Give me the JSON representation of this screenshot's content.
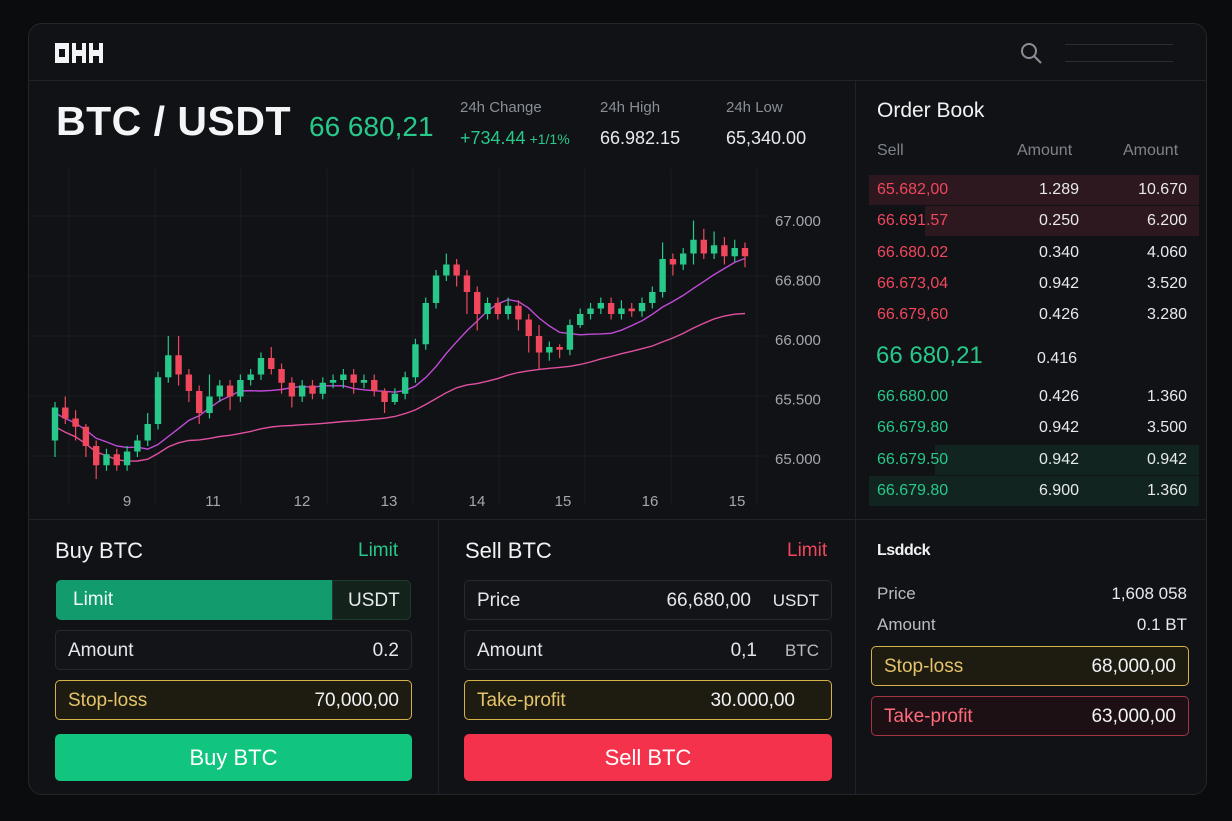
{
  "brand": {
    "logo": "OKX"
  },
  "header": {
    "pair": "BTC / USDT",
    "last_price": "66 680,21"
  },
  "stats": [
    {
      "label": "24h Change",
      "value": "+734.44",
      "sub": "+1/1%"
    },
    {
      "label": "24h High",
      "value": "66.982.15"
    },
    {
      "label": "24h Low",
      "value": "65,340.00"
    }
  ],
  "colors": {
    "up": "#27c88a",
    "down": "#f0475d",
    "ma_fast": "#c14bd8",
    "ma_slow": "#e0509e",
    "accent_gold": "#d6b34a"
  },
  "chart_data": {
    "type": "candlestick",
    "y_tick_labels": [
      "67.000",
      "66.800",
      "66.000",
      "65.500",
      "65.000"
    ],
    "x_tick_labels": [
      "9",
      "11",
      "12",
      "13",
      "14",
      "15",
      "16",
      "15"
    ],
    "series": [
      {
        "values": [
          [
            0.14,
            0.26,
            0.08,
            0.28
          ],
          [
            0.26,
            0.22,
            0.2,
            0.3
          ],
          [
            0.22,
            0.19,
            0.14,
            0.25
          ],
          [
            0.19,
            0.12,
            0.08,
            0.2
          ],
          [
            0.12,
            0.05,
            0.0,
            0.14
          ],
          [
            0.05,
            0.09,
            0.03,
            0.11
          ],
          [
            0.09,
            0.05,
            0.03,
            0.11
          ],
          [
            0.05,
            0.1,
            0.03,
            0.12
          ],
          [
            0.1,
            0.14,
            0.08,
            0.16
          ],
          [
            0.14,
            0.2,
            0.12,
            0.24
          ],
          [
            0.2,
            0.37,
            0.18,
            0.39
          ],
          [
            0.37,
            0.45,
            0.35,
            0.52
          ],
          [
            0.45,
            0.38,
            0.34,
            0.52
          ],
          [
            0.38,
            0.32,
            0.28,
            0.4
          ],
          [
            0.32,
            0.24,
            0.2,
            0.34
          ],
          [
            0.24,
            0.3,
            0.22,
            0.38
          ],
          [
            0.3,
            0.34,
            0.28,
            0.36
          ],
          [
            0.34,
            0.3,
            0.25,
            0.36
          ],
          [
            0.3,
            0.36,
            0.28,
            0.38
          ],
          [
            0.36,
            0.38,
            0.34,
            0.4
          ],
          [
            0.38,
            0.44,
            0.36,
            0.46
          ],
          [
            0.44,
            0.4,
            0.38,
            0.48
          ],
          [
            0.4,
            0.35,
            0.31,
            0.42
          ],
          [
            0.35,
            0.3,
            0.26,
            0.37
          ],
          [
            0.3,
            0.34,
            0.28,
            0.36
          ],
          [
            0.34,
            0.31,
            0.29,
            0.36
          ],
          [
            0.31,
            0.35,
            0.29,
            0.37
          ],
          [
            0.35,
            0.36,
            0.33,
            0.38
          ],
          [
            0.36,
            0.38,
            0.33,
            0.4
          ],
          [
            0.38,
            0.35,
            0.31,
            0.4
          ],
          [
            0.35,
            0.36,
            0.33,
            0.38
          ],
          [
            0.36,
            0.32,
            0.3,
            0.38
          ],
          [
            0.32,
            0.28,
            0.24,
            0.33
          ],
          [
            0.28,
            0.31,
            0.27,
            0.33
          ],
          [
            0.31,
            0.37,
            0.29,
            0.39
          ],
          [
            0.37,
            0.49,
            0.35,
            0.51
          ],
          [
            0.49,
            0.64,
            0.47,
            0.66
          ],
          [
            0.64,
            0.74,
            0.62,
            0.76
          ],
          [
            0.74,
            0.78,
            0.72,
            0.82
          ],
          [
            0.78,
            0.74,
            0.7,
            0.8
          ],
          [
            0.74,
            0.68,
            0.6,
            0.76
          ],
          [
            0.68,
            0.6,
            0.54,
            0.7
          ],
          [
            0.6,
            0.64,
            0.58,
            0.66
          ],
          [
            0.64,
            0.6,
            0.58,
            0.66
          ],
          [
            0.6,
            0.63,
            0.58,
            0.66
          ],
          [
            0.63,
            0.58,
            0.54,
            0.65
          ],
          [
            0.58,
            0.52,
            0.46,
            0.6
          ],
          [
            0.52,
            0.46,
            0.4,
            0.56
          ],
          [
            0.46,
            0.48,
            0.43,
            0.5
          ],
          [
            0.48,
            0.47,
            0.44,
            0.49
          ],
          [
            0.47,
            0.56,
            0.45,
            0.58
          ],
          [
            0.56,
            0.6,
            0.55,
            0.62
          ],
          [
            0.6,
            0.62,
            0.58,
            0.64
          ],
          [
            0.62,
            0.64,
            0.6,
            0.66
          ],
          [
            0.64,
            0.6,
            0.58,
            0.66
          ],
          [
            0.6,
            0.62,
            0.58,
            0.65
          ],
          [
            0.62,
            0.61,
            0.59,
            0.64
          ],
          [
            0.61,
            0.64,
            0.59,
            0.66
          ],
          [
            0.64,
            0.68,
            0.62,
            0.7
          ],
          [
            0.68,
            0.8,
            0.66,
            0.86
          ],
          [
            0.8,
            0.78,
            0.74,
            0.82
          ],
          [
            0.78,
            0.82,
            0.76,
            0.84
          ],
          [
            0.82,
            0.87,
            0.78,
            0.94
          ],
          [
            0.87,
            0.82,
            0.8,
            0.91
          ],
          [
            0.82,
            0.85,
            0.8,
            0.9
          ],
          [
            0.85,
            0.81,
            0.78,
            0.88
          ],
          [
            0.81,
            0.84,
            0.79,
            0.87
          ],
          [
            0.84,
            0.81,
            0.77,
            0.86
          ]
        ]
      }
    ]
  },
  "order_book": {
    "title": "Order Book",
    "columns": [
      "Sell",
      "Amount",
      "Amount"
    ],
    "sells": [
      {
        "price": "65.682,00",
        "amount": "1.289",
        "total": "10.670",
        "depth": 1.0
      },
      {
        "price": "66.691.57",
        "amount": "0.250",
        "total": "6.200",
        "depth": 0.83
      },
      {
        "price": "66.680.02",
        "amount": "0.340",
        "total": "4.060",
        "depth": 0
      },
      {
        "price": "66.673,04",
        "amount": "0.942",
        "total": "3.520",
        "depth": 0
      },
      {
        "price": "66.679,60",
        "amount": "0.426",
        "total": "3.280",
        "depth": 0
      }
    ],
    "mid": {
      "price": "66 680,21",
      "amount": "0.416"
    },
    "buys": [
      {
        "price": "66.680.00",
        "amount": "0.426",
        "total": "1.360",
        "depth": 0
      },
      {
        "price": "66.679.80",
        "amount": "0.942",
        "total": "3.500",
        "depth": 0
      },
      {
        "price": "66.679.50",
        "amount": "0.942",
        "total": "0.942",
        "depth": 0.8
      },
      {
        "price": "66.679.80",
        "amount": "6.900",
        "total": "1.360",
        "depth": 1.0
      }
    ]
  },
  "buy_panel": {
    "title": "Buy BTC",
    "mode": "Limit",
    "order_type": "Limit",
    "currency": "USDT",
    "amount_label": "Amount",
    "amount_value": "0.2",
    "stop_label": "Stop-loss",
    "stop_value": "70,000,00",
    "button": "Buy BTC"
  },
  "sell_panel": {
    "title": "Sell BTC",
    "mode": "Limit",
    "price_label": "Price",
    "price_value": "66,680,00",
    "price_unit": "USDT",
    "amount_label": "Amount",
    "amount_value": "0,1",
    "amount_unit": "BTC",
    "tp_label": "Take-profit",
    "tp_value": "30.000,00",
    "button": "Sell BTC"
  },
  "side_panel": {
    "title": "Lsddck",
    "price_label": "Price",
    "price_value": "1,608 058",
    "amount_label": "Amount",
    "amount_value": "0.1 BT",
    "stop_label": "Stop-loss",
    "stop_value": "68,000,00",
    "tp_label": "Take-profit",
    "tp_value": "63,000,00"
  }
}
